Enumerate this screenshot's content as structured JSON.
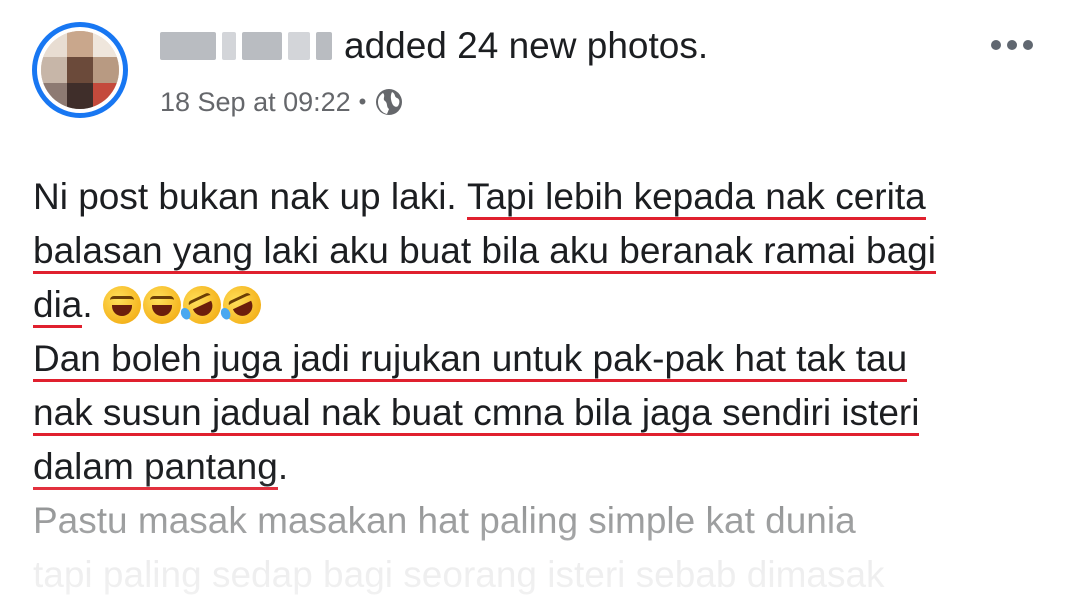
{
  "post": {
    "author_action": "added 24 new photos.",
    "timestamp": "18 Sep at 09:22",
    "separator": "•",
    "privacy_icon": "globe-icon",
    "more_icon": "more-horizontal-icon"
  },
  "body": {
    "line1_plain": "Ni post bukan nak up laki. ",
    "line1_underlined": "Tapi lebih kepada nak cerita",
    "line2_underlined": "balasan yang laki aku buat bila aku beranak ramai bagi",
    "line3_underlined": "dia",
    "line3_plain": ". ",
    "emojis": [
      "grinning-squinting-face",
      "grinning-squinting-face",
      "rolling-on-floor-laughing",
      "rolling-on-floor-laughing"
    ],
    "line4_underlined": "Dan boleh juga jadi rujukan untuk pak-pak hat tak tau",
    "line5_underlined": "nak susun jadual nak buat cmna bila jaga sendiri isteri",
    "line6_underlined": "dalam pantang",
    "line6_plain": ".",
    "line7": "Pastu masak masakan hat paling simple kat dunia",
    "line8": "tapi paling sedap bagi seorang isteri sebab dimasak"
  },
  "colors": {
    "accent": "#1877f2",
    "underline": "#e0202e",
    "meta_text": "#65676b"
  }
}
